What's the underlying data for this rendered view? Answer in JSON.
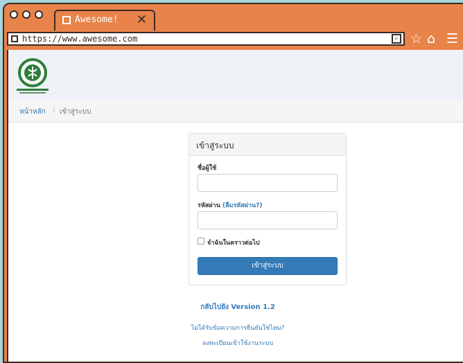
{
  "browser": {
    "tab_title": "Awesome!",
    "tab_close": "✕",
    "url": "https://www.awesome.com",
    "search_glyph": "⌕",
    "star_glyph": "☆",
    "home_glyph": "⌂",
    "menu_glyph": "☰"
  },
  "colors": {
    "window_frame": "#e8834a",
    "background": "#a9d5dc",
    "primary_button": "#337ab7"
  },
  "header": {
    "title_lines": [
      "",
      "",
      ""
    ]
  },
  "breadcrumb": {
    "home": "หน้าหลัก",
    "separator": "/",
    "current": "เข้าสู่ระบบ"
  },
  "login": {
    "heading": "เข้าสู่ระบบ",
    "username_label": "ชื่อผู้ใช้",
    "password_label": "รหัสผ่าน",
    "forgot_password": "(ลืมรหัสผ่าน?)",
    "remember_label": "จำฉันในคราวต่อไป",
    "submit": "เข้าสู่ระบบ"
  },
  "links": {
    "back_version": "กลับไปยัง Version 1.2",
    "no_confirm_email": "ไม่ได้รับข้อความการยืนยันใช่ไหม?",
    "register": "ลงทะเบียนเข้าใช้งานระบบ"
  }
}
